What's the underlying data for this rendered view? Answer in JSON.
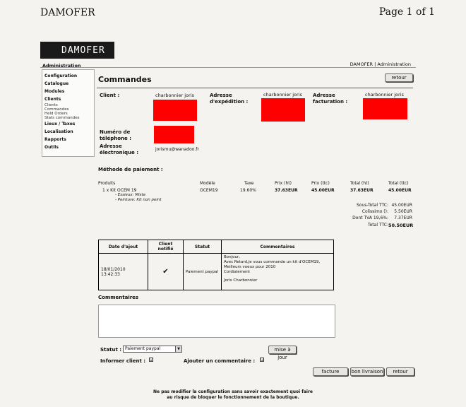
{
  "doc": {
    "title": "DAMOFER",
    "page": "Page 1 of 1"
  },
  "brand": {
    "logo": "DAMOFER",
    "subtitle": "Administration"
  },
  "topnav": {
    "shop": "DAMOFER",
    "sep": "|",
    "admin": "Administration"
  },
  "sidebar": {
    "items": [
      "Configuration",
      "Catalogue",
      "Modules",
      "Clients"
    ],
    "subitems": [
      "Clients",
      "Commandes",
      "Held Orders",
      "Stats commandes"
    ],
    "items2": [
      "Lieux / Taxes",
      "Localisation",
      "Rapports",
      "Outils"
    ]
  },
  "section": {
    "title": "Commandes",
    "retour": "retour"
  },
  "customer": {
    "client_label": "Client :",
    "client_name": "charbonnier joris",
    "shipping_label_1": "Adresse",
    "shipping_label_2": "d'expédition :",
    "shipping_name": "charbonnier joris",
    "billing_label_1": "Adresse",
    "billing_label_2": "facturation :",
    "billing_name": "charbonnier joris",
    "phone_label_1": "Numéro de",
    "phone_label_2": "téléphone :",
    "email_label_1": "Adresse",
    "email_label_2": "électronique :",
    "email": "jorismu@wanadoo.fr",
    "payment_label": "Méthode de paiement :"
  },
  "products": {
    "headers": [
      "Produits",
      "Modèle",
      "Taxe",
      "Prix (ht)",
      "Prix (ttc)",
      "Total (ht)",
      "Total (ttc)"
    ],
    "row": {
      "name": "1 x Kit OCEM 19",
      "attr1": "- Essieux: Mixte",
      "attr2": "- Peinture: Kit non peint",
      "model": "OCEM19",
      "tax": "19.60%",
      "price_ht": "37.63EUR",
      "price_ttc": "45.00EUR",
      "total_ht": "37.63EUR",
      "total_ttc": "45.00EUR"
    }
  },
  "totals": [
    {
      "label": "Sous-Total TTC:",
      "value": "45.00EUR"
    },
    {
      "label": "Colissimo ():",
      "value": "5.50EUR"
    },
    {
      "label": "Dont TVA 19,6%:",
      "value": "7.37EUR"
    },
    {
      "label": "Total TTC:",
      "value": "50.50EUR"
    }
  ],
  "history": {
    "headers": [
      "Date d'ajout",
      "Client notifié",
      "Statut",
      "Commentaires"
    ],
    "row": {
      "date": "18/01/2010 13:42:33",
      "notified": "✔",
      "status": "Paiement paypal",
      "comment": [
        "Bonjour,",
        "Avec Retard,je vous commande un kit d'OCEM19,",
        "Meilleurs voeux pour 2010",
        "Cordialement",
        "",
        "Joris Charbonnier"
      ]
    }
  },
  "comments": {
    "title": "Commentaires"
  },
  "form": {
    "status_label": "Statut :",
    "status_value": "Paiement paypal",
    "update_button": "mise à jour",
    "notify_label": "Informer client :",
    "notify_checked": "☑",
    "add_comment_label": "Ajouter un commentaire :",
    "add_comment_checked": "☑",
    "buttons": [
      "facture",
      "bon livraison",
      "retour"
    ]
  },
  "footer": {
    "line1": "Ne pas modifier la configuration sans savoir exactement quoi faire",
    "line2": "au risque de bloquer le fonctionnement de la boutique."
  }
}
